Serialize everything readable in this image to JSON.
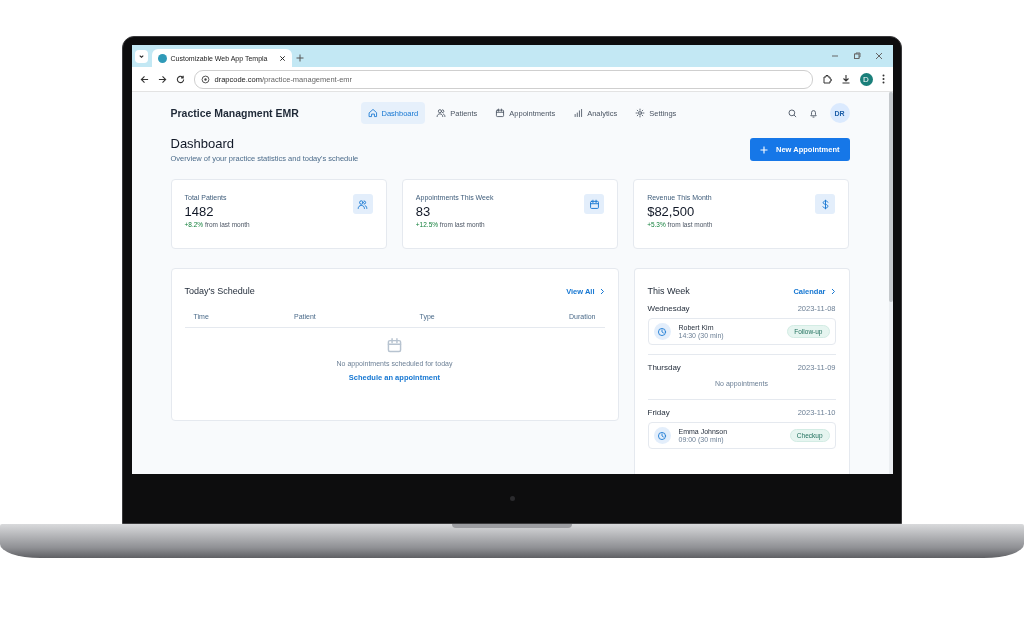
{
  "browser": {
    "tab_title": "Customizable Web App Templa",
    "url_domain": "drapcode.com",
    "url_path": "/practice-management-emr",
    "profile": "D"
  },
  "header": {
    "brand": "Practice Managment EMR",
    "avatar": "DR"
  },
  "nav": [
    {
      "label": "Dashboard",
      "kind": "home",
      "selected": true
    },
    {
      "label": "Patients",
      "kind": "users",
      "selected": false
    },
    {
      "label": "Appointments",
      "kind": "calendar",
      "selected": false
    },
    {
      "label": "Analytics",
      "kind": "bars",
      "selected": false
    },
    {
      "label": "Settings",
      "kind": "gear",
      "selected": false
    }
  ],
  "page": {
    "title": "Dashboard",
    "subtitle": "Overview of your practice statistics and today's schedule",
    "new_button": "New Appointment"
  },
  "stats": [
    {
      "label": "Total Patients",
      "value": "1482",
      "change": "+8.2%",
      "note": "from last month",
      "kind": "users"
    },
    {
      "label": "Appointments This Week",
      "value": "83",
      "change": "+12.5%",
      "note": "from last month",
      "kind": "calendar"
    },
    {
      "label": "Revenue This Month",
      "value": "$82,500",
      "change": "+5.3%",
      "note": "from last month",
      "kind": "dollar"
    }
  ],
  "schedule": {
    "title": "Today's Schedule",
    "link": "View All",
    "columns": [
      "Time",
      "Patient",
      "Type",
      "Duration"
    ],
    "empty_text": "No appointments scheduled for today",
    "empty_link": "Schedule an appointment"
  },
  "week": {
    "title": "This Week",
    "link": "Calendar",
    "days": [
      {
        "name": "Wednesday",
        "date": "2023-11-08",
        "appointments": [
          {
            "patient": "Robert Kim",
            "time": "14:30 (30 min)",
            "type": "Follow-up"
          }
        ]
      },
      {
        "name": "Thursday",
        "date": "2023-11-09",
        "empty_text": "No appointments"
      },
      {
        "name": "Friday",
        "date": "2023-11-10",
        "appointments": [
          {
            "patient": "Emma Johnson",
            "time": "09:00 (30 min)",
            "type": "Checkup"
          }
        ]
      }
    ]
  }
}
